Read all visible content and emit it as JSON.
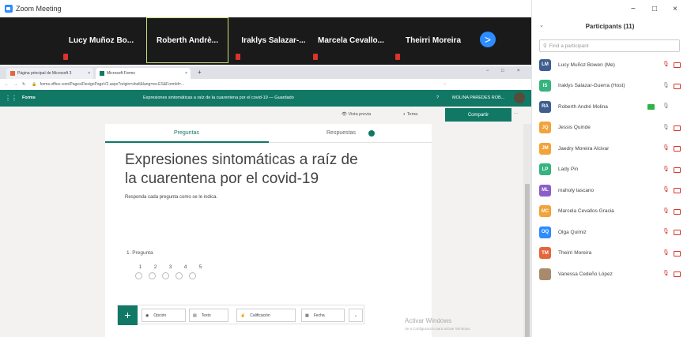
{
  "window": {
    "title": "Zoom Meeting"
  },
  "video_strip": {
    "tiles": [
      {
        "name": "Lucy Muñoz Bo...",
        "muted": true
      },
      {
        "name": "Roberth Andrè...",
        "muted": false,
        "active": true
      },
      {
        "name": "Iraklys Salazar-...",
        "muted": true
      },
      {
        "name": "Marcela Cevallo...",
        "muted": true
      },
      {
        "name": "Theirri Moreira",
        "muted": true
      }
    ],
    "next_glyph": ">"
  },
  "browser": {
    "tabs": [
      {
        "label": "Página principal de Microsoft 3",
        "close": "×"
      },
      {
        "label": "Microsoft Forms",
        "close": "×"
      }
    ],
    "new_tab": "+",
    "window_controls": [
      "−",
      "□",
      "×"
    ],
    "url": "forms.office.com/Pages/DesignPageV2.aspx?origin=shell&lang=es-ES&FormId=...",
    "forms_bar": {
      "app_name": "Forms",
      "center_title": "Expresiones sintomáticas a raíz de la cuarentena por el covid-19 — Guardado",
      "help": "?",
      "user": "MOLINA PAREDES ROB..."
    },
    "toolbar": {
      "preview": "Vista previa",
      "theme": "Tema",
      "share": "Compartir",
      "more": "···"
    }
  },
  "form": {
    "tab_questions": "Preguntas",
    "tab_responses": "Respuestas",
    "title": "Expresiones sintomáticas a raíz de la cuarentena por el covid-19",
    "description": "Responda cada pregunta como se le indica.",
    "question": "1. Pregunta",
    "scale": [
      "1",
      "2",
      "3",
      "4",
      "5"
    ],
    "add_button": "+",
    "question_types": [
      {
        "label": "Opción",
        "icon": "radio-icon"
      },
      {
        "label": "Texto",
        "icon": "text-icon"
      },
      {
        "label": "Calificación",
        "icon": "rating-icon"
      },
      {
        "label": "Fecha",
        "icon": "calendar-icon"
      }
    ],
    "more_types_glyph": "⌄"
  },
  "watermark": {
    "line1": "Activar Windows",
    "line2": "Ve a Configuración para activar Windows."
  },
  "participants_panel": {
    "window_controls": [
      "−",
      "□",
      "×"
    ],
    "title": "Participants (11)",
    "search_placeholder": "Find a participant",
    "participants": [
      {
        "initials": "LM",
        "name": "Lucy Muñoz Bowen (Me)",
        "color": "#3f5e8f",
        "audio": "muted",
        "video": "off"
      },
      {
        "initials": "IS",
        "name": "Iraklys Salazar-Guerra (Host)",
        "color": "#36b37e",
        "audio": "on",
        "video": "off"
      },
      {
        "initials": "RA",
        "name": "Roberth André Molina",
        "color": "#3f5e8f",
        "audio": "on",
        "video": "on"
      },
      {
        "initials": "JQ",
        "name": "Jessis Quinde",
        "color": "#f2a33a",
        "audio": "on",
        "video": "off"
      },
      {
        "initials": "JM",
        "name": "Jaedry Moreira Alcivar",
        "color": "#f2a33a",
        "audio": "muted",
        "video": "off"
      },
      {
        "initials": "LP",
        "name": "Lady Pin",
        "color": "#36b37e",
        "audio": "muted",
        "video": "off"
      },
      {
        "initials": "ML",
        "name": "maholy lascano",
        "color": "#8b5fc7",
        "audio": "muted",
        "video": "off"
      },
      {
        "initials": "MC",
        "name": "Marcela Cevallos Gracia",
        "color": "#f2a33a",
        "audio": "muted",
        "video": "off"
      },
      {
        "initials": "OQ",
        "name": "Olga Quimiz",
        "color": "#2d8cff",
        "audio": "muted",
        "video": "off"
      },
      {
        "initials": "TM",
        "name": "Theirri Moreira",
        "color": "#e5653d",
        "audio": "muted",
        "video": "off"
      },
      {
        "initials": "",
        "name": "Vanessa Cedeño López",
        "color": "#a88a6e",
        "audio": "muted",
        "video": "off"
      }
    ]
  },
  "colors": {
    "forms_green": "#117865",
    "zoom_blue": "#2d8cff",
    "mute_red": "#d9342b",
    "video_green": "#2fb344"
  }
}
